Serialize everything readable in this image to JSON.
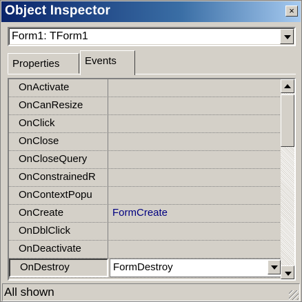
{
  "window": {
    "title": "Object Inspector",
    "close_glyph": "×"
  },
  "object_selector": {
    "value": "Form1: TForm1"
  },
  "tabs": [
    {
      "label": "Properties",
      "active": false
    },
    {
      "label": "Events",
      "active": true
    }
  ],
  "events": [
    {
      "name": "OnActivate",
      "handler": ""
    },
    {
      "name": "OnCanResize",
      "handler": ""
    },
    {
      "name": "OnClick",
      "handler": ""
    },
    {
      "name": "OnClose",
      "handler": ""
    },
    {
      "name": "OnCloseQuery",
      "handler": ""
    },
    {
      "name": "OnConstrainedR",
      "handler": ""
    },
    {
      "name": "OnContextPopu",
      "handler": ""
    },
    {
      "name": "OnCreate",
      "handler": "FormCreate"
    },
    {
      "name": "OnDblClick",
      "handler": ""
    },
    {
      "name": "OnDeactivate",
      "handler": ""
    },
    {
      "name": "OnDestroy",
      "handler": "FormDestroy",
      "selected": true
    }
  ],
  "statusbar": {
    "text": "All shown"
  },
  "colors": {
    "title_start": "#0a246a",
    "title_end": "#a6caf0",
    "face": "#d4d0c8",
    "handler_text": "#000080"
  }
}
